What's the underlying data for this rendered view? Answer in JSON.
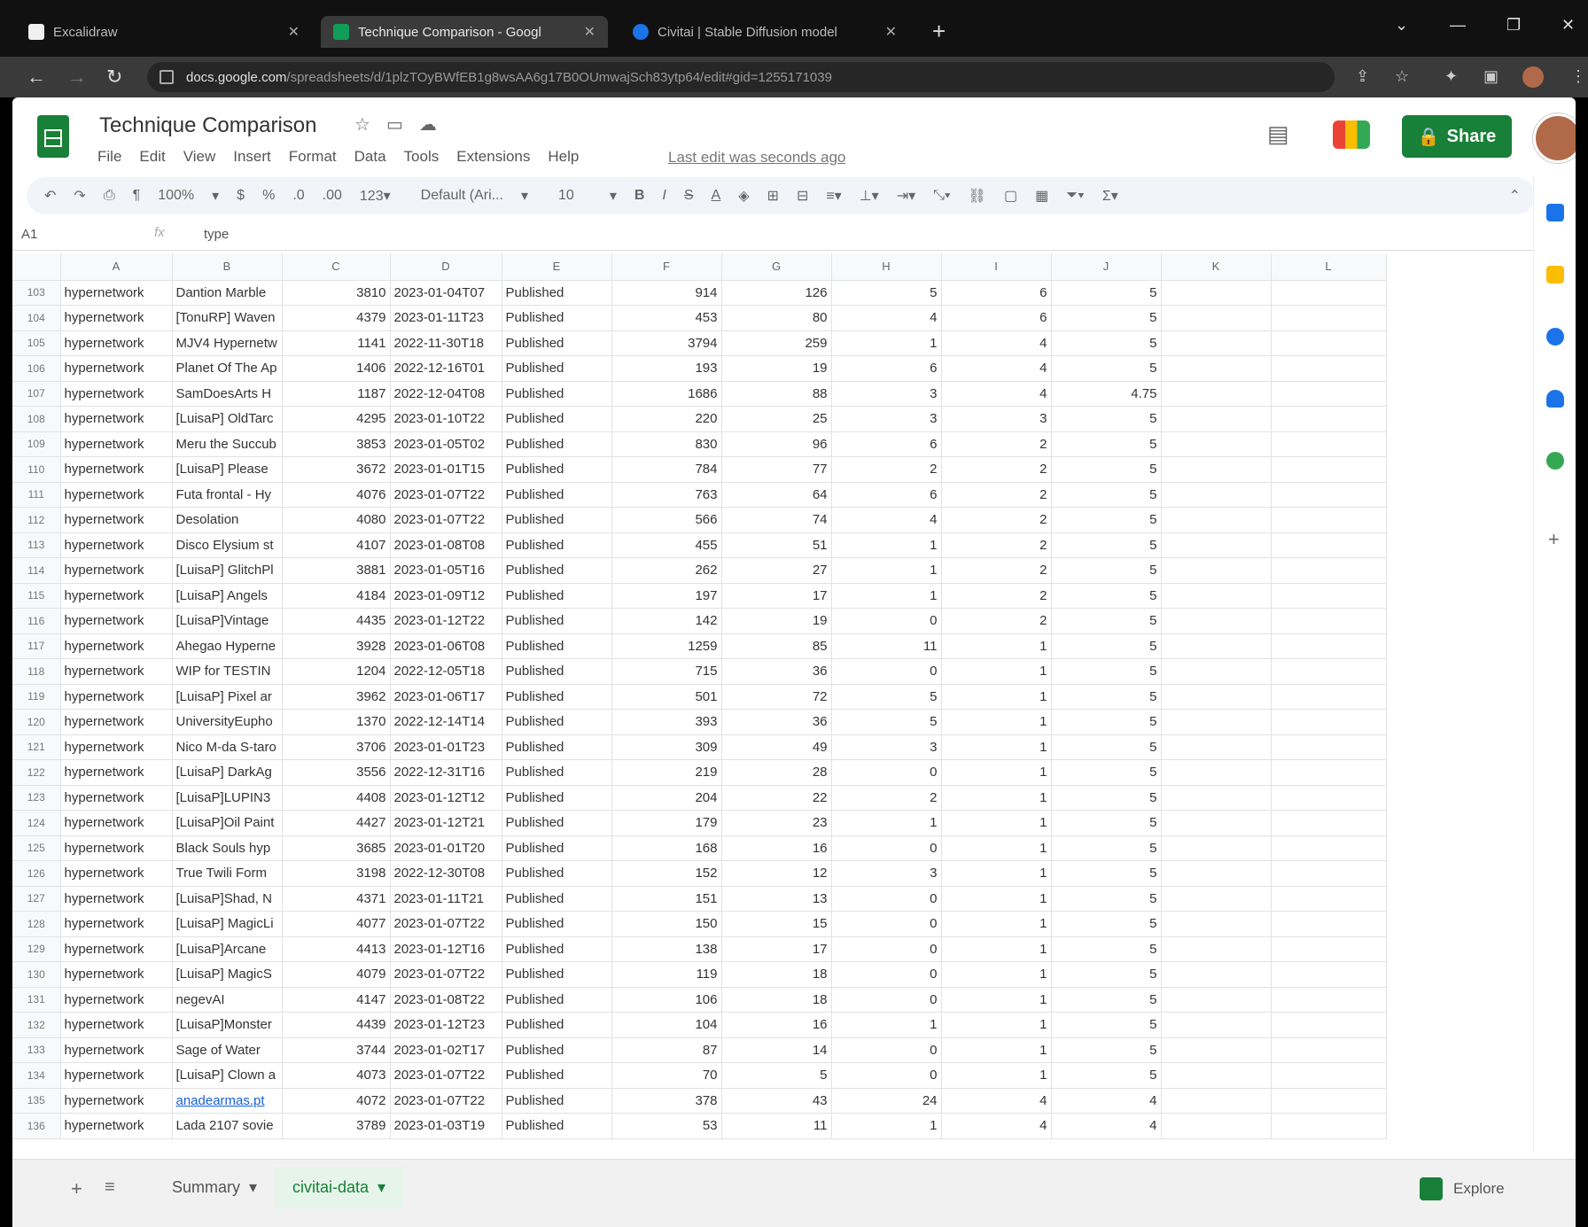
{
  "browser": {
    "tabs": [
      {
        "title": "Excalidraw",
        "active": false,
        "color": "#f0f0f0"
      },
      {
        "title": "Technique Comparison - Googl",
        "active": true,
        "color": "#0f9d58"
      },
      {
        "title": "Civitai | Stable Diffusion model",
        "active": false,
        "color": "#1a73e8"
      }
    ],
    "url_host": "docs.google.com",
    "url_path": "/spreadsheets/d/1plzTOyBWfEB1g8wsAA6g17B0OUmwajSch83ytp64/edit#gid=1255171039"
  },
  "sheet": {
    "title": "Technique Comparison",
    "menu": [
      "File",
      "Edit",
      "View",
      "Insert",
      "Format",
      "Data",
      "Tools",
      "Extensions",
      "Help"
    ],
    "last_edit": "Last edit was seconds ago",
    "share_label": "Share",
    "zoom": "100%",
    "font": "Default (Ari...",
    "font_size": "10",
    "name_box": "A1",
    "formula": "type",
    "columns": [
      "A",
      "B",
      "C",
      "D",
      "E",
      "F",
      "G",
      "H",
      "I",
      "J",
      "K",
      "L"
    ],
    "rows": [
      {
        "n": "103",
        "a": "hypernetwork",
        "b": "Dantion Marble",
        "c": "3810",
        "d": "2023-01-04T07",
        "e": "Published",
        "f": "914",
        "g": "126",
        "h": "5",
        "i": "6",
        "j": "5"
      },
      {
        "n": "104",
        "a": "hypernetwork",
        "b": "[TonuRP] Waven",
        "c": "4379",
        "d": "2023-01-11T23",
        "e": "Published",
        "f": "453",
        "g": "80",
        "h": "4",
        "i": "6",
        "j": "5"
      },
      {
        "n": "105",
        "a": "hypernetwork",
        "b": "MJV4 Hypernetw",
        "c": "1141",
        "d": "2022-11-30T18",
        "e": "Published",
        "f": "3794",
        "g": "259",
        "h": "1",
        "i": "4",
        "j": "5"
      },
      {
        "n": "106",
        "a": "hypernetwork",
        "b": "Planet Of The Ap",
        "c": "1406",
        "d": "2022-12-16T01",
        "e": "Published",
        "f": "193",
        "g": "19",
        "h": "6",
        "i": "4",
        "j": "5"
      },
      {
        "n": "107",
        "a": "hypernetwork",
        "b": "SamDoesArts H",
        "c": "1187",
        "d": "2022-12-04T08",
        "e": "Published",
        "f": "1686",
        "g": "88",
        "h": "3",
        "i": "4",
        "j": "4.75"
      },
      {
        "n": "108",
        "a": "hypernetwork",
        "b": "[LuisaP] OldTarc",
        "c": "4295",
        "d": "2023-01-10T22",
        "e": "Published",
        "f": "220",
        "g": "25",
        "h": "3",
        "i": "3",
        "j": "5"
      },
      {
        "n": "109",
        "a": "hypernetwork",
        "b": "Meru the Succub",
        "c": "3853",
        "d": "2023-01-05T02",
        "e": "Published",
        "f": "830",
        "g": "96",
        "h": "6",
        "i": "2",
        "j": "5"
      },
      {
        "n": "110",
        "a": "hypernetwork",
        "b": "[LuisaP] Please",
        "c": "3672",
        "d": "2023-01-01T15",
        "e": "Published",
        "f": "784",
        "g": "77",
        "h": "2",
        "i": "2",
        "j": "5"
      },
      {
        "n": "111",
        "a": "hypernetwork",
        "b": "Futa frontal - Hy",
        "c": "4076",
        "d": "2023-01-07T22",
        "e": "Published",
        "f": "763",
        "g": "64",
        "h": "6",
        "i": "2",
        "j": "5"
      },
      {
        "n": "112",
        "a": "hypernetwork",
        "b": "Desolation",
        "c": "4080",
        "d": "2023-01-07T22",
        "e": "Published",
        "f": "566",
        "g": "74",
        "h": "4",
        "i": "2",
        "j": "5"
      },
      {
        "n": "113",
        "a": "hypernetwork",
        "b": "Disco Elysium st",
        "c": "4107",
        "d": "2023-01-08T08",
        "e": "Published",
        "f": "455",
        "g": "51",
        "h": "1",
        "i": "2",
        "j": "5"
      },
      {
        "n": "114",
        "a": "hypernetwork",
        "b": "[LuisaP] GlitchPl",
        "c": "3881",
        "d": "2023-01-05T16",
        "e": "Published",
        "f": "262",
        "g": "27",
        "h": "1",
        "i": "2",
        "j": "5"
      },
      {
        "n": "115",
        "a": "hypernetwork",
        "b": "[LuisaP] Angels",
        "c": "4184",
        "d": "2023-01-09T12",
        "e": "Published",
        "f": "197",
        "g": "17",
        "h": "1",
        "i": "2",
        "j": "5"
      },
      {
        "n": "116",
        "a": "hypernetwork",
        "b": "[LuisaP]Vintage",
        "c": "4435",
        "d": "2023-01-12T22",
        "e": "Published",
        "f": "142",
        "g": "19",
        "h": "0",
        "i": "2",
        "j": "5"
      },
      {
        "n": "117",
        "a": "hypernetwork",
        "b": "Ahegao Hyperne",
        "c": "3928",
        "d": "2023-01-06T08",
        "e": "Published",
        "f": "1259",
        "g": "85",
        "h": "11",
        "i": "1",
        "j": "5"
      },
      {
        "n": "118",
        "a": "hypernetwork",
        "b": "WIP for TESTIN",
        "c": "1204",
        "d": "2022-12-05T18",
        "e": "Published",
        "f": "715",
        "g": "36",
        "h": "0",
        "i": "1",
        "j": "5"
      },
      {
        "n": "119",
        "a": "hypernetwork",
        "b": "[LuisaP] Pixel ar",
        "c": "3962",
        "d": "2023-01-06T17",
        "e": "Published",
        "f": "501",
        "g": "72",
        "h": "5",
        "i": "1",
        "j": "5"
      },
      {
        "n": "120",
        "a": "hypernetwork",
        "b": "UniversityEupho",
        "c": "1370",
        "d": "2022-12-14T14",
        "e": "Published",
        "f": "393",
        "g": "36",
        "h": "5",
        "i": "1",
        "j": "5"
      },
      {
        "n": "121",
        "a": "hypernetwork",
        "b": "Nico M-da S-taro",
        "c": "3706",
        "d": "2023-01-01T23",
        "e": "Published",
        "f": "309",
        "g": "49",
        "h": "3",
        "i": "1",
        "j": "5"
      },
      {
        "n": "122",
        "a": "hypernetwork",
        "b": "[LuisaP] DarkAg",
        "c": "3556",
        "d": "2022-12-31T16",
        "e": "Published",
        "f": "219",
        "g": "28",
        "h": "0",
        "i": "1",
        "j": "5"
      },
      {
        "n": "123",
        "a": "hypernetwork",
        "b": "[LuisaP]LUPIN3",
        "c": "4408",
        "d": "2023-01-12T12",
        "e": "Published",
        "f": "204",
        "g": "22",
        "h": "2",
        "i": "1",
        "j": "5"
      },
      {
        "n": "124",
        "a": "hypernetwork",
        "b": "[LuisaP]Oil Paint",
        "c": "4427",
        "d": "2023-01-12T21",
        "e": "Published",
        "f": "179",
        "g": "23",
        "h": "1",
        "i": "1",
        "j": "5"
      },
      {
        "n": "125",
        "a": "hypernetwork",
        "b": "Black Souls hyp",
        "c": "3685",
        "d": "2023-01-01T20",
        "e": "Published",
        "f": "168",
        "g": "16",
        "h": "0",
        "i": "1",
        "j": "5"
      },
      {
        "n": "126",
        "a": "hypernetwork",
        "b": "True Twili Form",
        "c": "3198",
        "d": "2022-12-30T08",
        "e": "Published",
        "f": "152",
        "g": "12",
        "h": "3",
        "i": "1",
        "j": "5"
      },
      {
        "n": "127",
        "a": "hypernetwork",
        "b": "[LuisaP]Shad, N",
        "c": "4371",
        "d": "2023-01-11T21",
        "e": "Published",
        "f": "151",
        "g": "13",
        "h": "0",
        "i": "1",
        "j": "5"
      },
      {
        "n": "128",
        "a": "hypernetwork",
        "b": "[LuisaP] MagicLi",
        "c": "4077",
        "d": "2023-01-07T22",
        "e": "Published",
        "f": "150",
        "g": "15",
        "h": "0",
        "i": "1",
        "j": "5"
      },
      {
        "n": "129",
        "a": "hypernetwork",
        "b": "[LuisaP]Arcane",
        "c": "4413",
        "d": "2023-01-12T16",
        "e": "Published",
        "f": "138",
        "g": "17",
        "h": "0",
        "i": "1",
        "j": "5"
      },
      {
        "n": "130",
        "a": "hypernetwork",
        "b": "[LuisaP] MagicS",
        "c": "4079",
        "d": "2023-01-07T22",
        "e": "Published",
        "f": "119",
        "g": "18",
        "h": "0",
        "i": "1",
        "j": "5"
      },
      {
        "n": "131",
        "a": "hypernetwork",
        "b": "negevAI",
        "c": "4147",
        "d": "2023-01-08T22",
        "e": "Published",
        "f": "106",
        "g": "18",
        "h": "0",
        "i": "1",
        "j": "5"
      },
      {
        "n": "132",
        "a": "hypernetwork",
        "b": "[LuisaP]Monster",
        "c": "4439",
        "d": "2023-01-12T23",
        "e": "Published",
        "f": "104",
        "g": "16",
        "h": "1",
        "i": "1",
        "j": "5"
      },
      {
        "n": "133",
        "a": "hypernetwork",
        "b": "Sage of Water",
        "c": "3744",
        "d": "2023-01-02T17",
        "e": "Published",
        "f": "87",
        "g": "14",
        "h": "0",
        "i": "1",
        "j": "5"
      },
      {
        "n": "134",
        "a": "hypernetwork",
        "b": "[LuisaP] Clown a",
        "c": "4073",
        "d": "2023-01-07T22",
        "e": "Published",
        "f": "70",
        "g": "5",
        "h": "0",
        "i": "1",
        "j": "5"
      },
      {
        "n": "135",
        "a": "hypernetwork",
        "b": "anadearmas.pt",
        "c": "4072",
        "d": "2023-01-07T22",
        "e": "Published",
        "f": "378",
        "g": "43",
        "h": "24",
        "i": "4",
        "j": "4",
        "link": true
      },
      {
        "n": "136",
        "a": "hypernetwork",
        "b": "Lada 2107 sovie",
        "c": "3789",
        "d": "2023-01-03T19",
        "e": "Published",
        "f": "53",
        "g": "11",
        "h": "1",
        "i": "4",
        "j": "4"
      }
    ],
    "sheet_tabs": [
      {
        "label": "Summary",
        "active": false
      },
      {
        "label": "civitai-data",
        "active": true
      }
    ],
    "explore_label": "Explore"
  }
}
